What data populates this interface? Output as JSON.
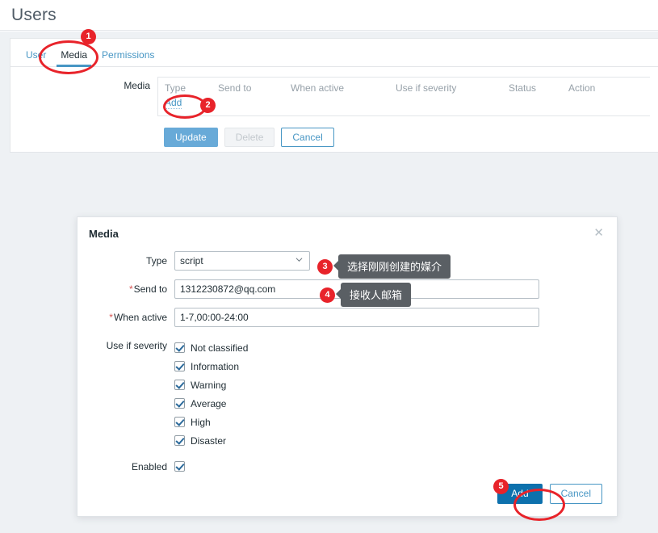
{
  "page": {
    "title": "Users"
  },
  "tabs": [
    {
      "label": "User",
      "active": false
    },
    {
      "label": "Media",
      "active": true
    },
    {
      "label": "Permissions",
      "active": false
    }
  ],
  "media_section": {
    "label": "Media",
    "columns": [
      "Type",
      "Send to",
      "When active",
      "Use if severity",
      "Status",
      "Action"
    ],
    "add_link": "Add"
  },
  "form_buttons": {
    "update": "Update",
    "delete": "Delete",
    "cancel": "Cancel"
  },
  "modal": {
    "title": "Media",
    "close_icon": "close-icon",
    "fields": {
      "type_label": "Type",
      "type_value": "script",
      "sendto_label": "Send to",
      "sendto_value": "1312230872@qq.com",
      "when_label": "When active",
      "when_value": "1-7,00:00-24:00",
      "severity_label": "Use if severity",
      "enabled_label": "Enabled"
    },
    "severities": [
      {
        "label": "Not classified",
        "checked": true
      },
      {
        "label": "Information",
        "checked": true
      },
      {
        "label": "Warning",
        "checked": true
      },
      {
        "label": "Average",
        "checked": true
      },
      {
        "label": "High",
        "checked": true
      },
      {
        "label": "Disaster",
        "checked": true
      }
    ],
    "enabled_checked": true,
    "buttons": {
      "add": "Add",
      "cancel": "Cancel"
    }
  },
  "annotations": {
    "markers": [
      "1",
      "2",
      "3",
      "4",
      "5"
    ],
    "tooltips": [
      {
        "id": "3",
        "text": "选择刚刚创建的媒介"
      },
      {
        "id": "4",
        "text": "接收人邮箱"
      }
    ],
    "highlight_color": "#e8232a"
  }
}
